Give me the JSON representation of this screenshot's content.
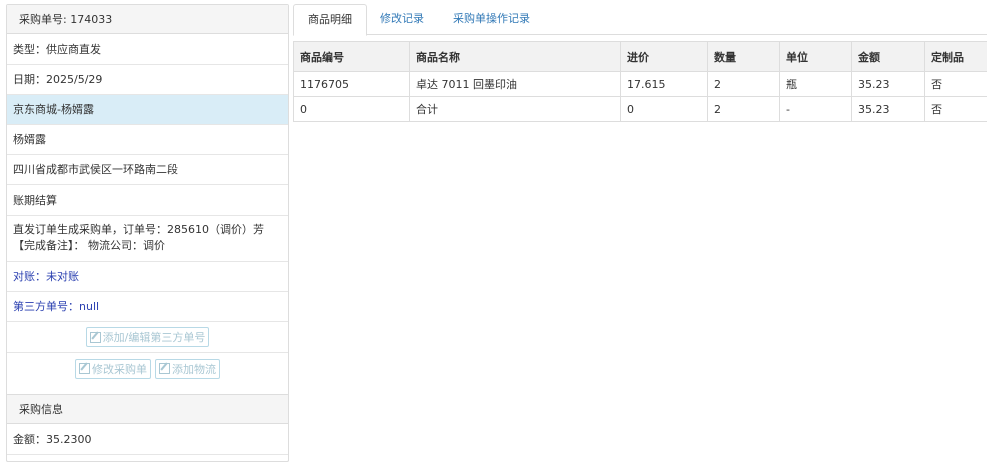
{
  "order_panel": {
    "header": "采购单号: 174033",
    "type": "类型：供应商直发",
    "date": "日期：2025/5/29",
    "shop": "京东商城-杨婿露",
    "contact": "杨婿露",
    "address": "四川省成都市武侯区一环路南二段",
    "settlement": "账期结算",
    "note_line1": "直发订单生成采购单，订单号：285610（调价）芳",
    "note_line2": "【完成备注】： 物流公司：调价",
    "reconcile": "对账：未对账",
    "third_party": "第三方单号：null",
    "btn_edit_third": "添加/编辑第三方单号",
    "btn_modify": "修改采购单",
    "btn_add_logistics": "添加物流"
  },
  "purchase_info": {
    "header": "采购信息",
    "amount": "金额：35.2300"
  },
  "tabs": [
    "商品明细",
    "修改记录",
    "采购单操作记录"
  ],
  "table": {
    "columns": [
      "商品编号",
      "商品名称",
      "进价",
      "数量",
      "单位",
      "金额",
      "定制品"
    ],
    "rows": [
      [
        "1176705",
        "卓达 7011 回墨印油",
        "17.615",
        "2",
        "瓶",
        "35.23",
        "否"
      ],
      [
        "0",
        "合计",
        "0",
        "2",
        "-",
        "35.23",
        "否"
      ]
    ]
  }
}
